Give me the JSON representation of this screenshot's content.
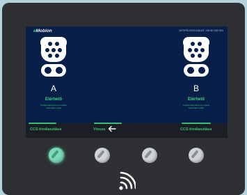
{
  "brand": {
    "prefix": "e",
    "name": "Mobion",
    "accent": "#49c97a"
  },
  "hotline": "ÜGYFÉLSZOLGÁLAT: +36 80 183 024",
  "connectors": [
    {
      "letter": "A",
      "status": "Elérhető",
      "note_line1": "A töltési kártyádról a mobilon",
      "note_line2": "használd a töltőt"
    },
    {
      "letter": "B",
      "status": "Elérhető",
      "note_line1": "A töltési kártyádról a mobilon",
      "note_line2": "használd a töltőt"
    }
  ],
  "softkeys": {
    "left": "CCS kiválasztása",
    "middle": "Vissza",
    "right": "CCS kiválasztása"
  },
  "icons": {
    "plug": "ccs-plug-icon",
    "back": "arrow-left-icon",
    "nfc": "contactless-icon"
  },
  "colors": {
    "screen": "#071f49",
    "status_green": "#3fd27a",
    "body": "#2e3033",
    "background": "#b4d3da"
  }
}
